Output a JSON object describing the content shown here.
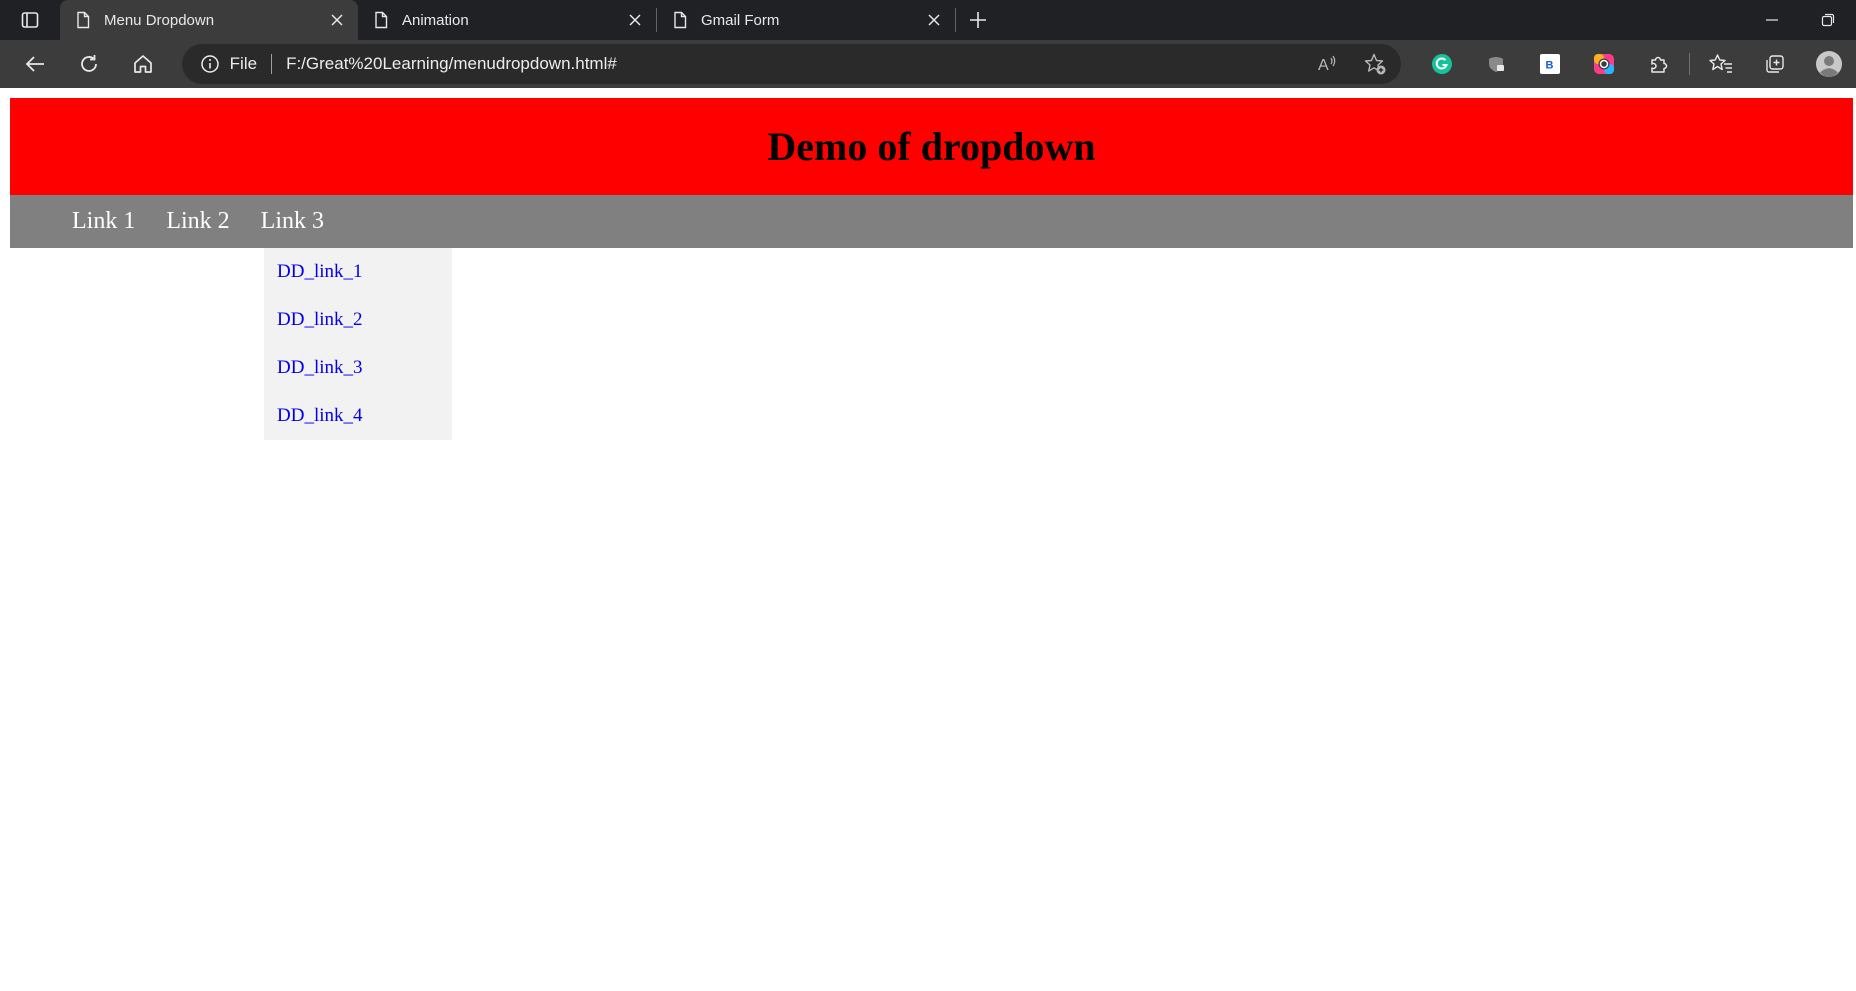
{
  "browser": {
    "tabs": [
      {
        "title": "Menu Dropdown",
        "active": true
      },
      {
        "title": "Animation",
        "active": false
      },
      {
        "title": "Gmail Form",
        "active": false
      }
    ],
    "address": {
      "scheme_label": "File",
      "url": "F:/Great%20Learning/menudropdown.html#"
    },
    "extensions": [
      "grammarly-icon",
      "shield-extension-icon",
      "bitwarden-icon",
      "color-picker-icon",
      "extensions-puzzle-icon",
      "favorites-icon",
      "collections-icon",
      "profile-avatar"
    ],
    "colors": {
      "tabbar": "#202124",
      "toolbar": "#3c3c3c",
      "grammarly": "#15c39a"
    }
  },
  "page": {
    "header_title": "Demo of dropdown",
    "nav_links": [
      "Link 1",
      "Link 2",
      "Link 3"
    ],
    "dropdown_links": [
      "DD_link_1",
      "DD_link_2",
      "DD_link_3",
      "DD_link_4"
    ],
    "colors": {
      "header_bg": "#ff0000",
      "nav_bg": "#808080",
      "dropdown_bg": "#f2f2f2",
      "link_color": "#0000ee"
    }
  }
}
